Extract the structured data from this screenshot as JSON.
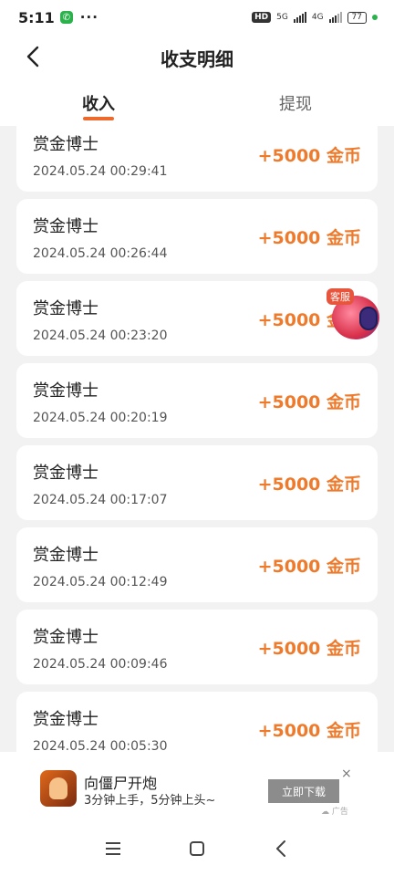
{
  "status_bar": {
    "time": "5:11",
    "more": "···",
    "hd": "HD",
    "net1": "5G",
    "net2": "4G",
    "battery": "77"
  },
  "header": {
    "title": "收支明细",
    "back_icon": "chevron-left-icon"
  },
  "tabs": [
    {
      "label": "收入",
      "active": true
    },
    {
      "label": "提现",
      "active": false
    }
  ],
  "records": [
    {
      "name": "赏金博士",
      "date": "2024.05.24 00:29:41",
      "amount": "+5000 金币"
    },
    {
      "name": "赏金博士",
      "date": "2024.05.24 00:26:44",
      "amount": "+5000 金币"
    },
    {
      "name": "赏金博士",
      "date": "2024.05.24 00:23:20",
      "amount": "+5000 金币"
    },
    {
      "name": "赏金博士",
      "date": "2024.05.24 00:20:19",
      "amount": "+5000 金币"
    },
    {
      "name": "赏金博士",
      "date": "2024.05.24 00:17:07",
      "amount": "+5000 金币"
    },
    {
      "name": "赏金博士",
      "date": "2024.05.24 00:12:49",
      "amount": "+5000 金币"
    },
    {
      "name": "赏金博士",
      "date": "2024.05.24 00:09:46",
      "amount": "+5000 金币"
    },
    {
      "name": "赏金博士",
      "date": "2024.05.24 00:05:30",
      "amount": "+5000 金币"
    }
  ],
  "customer_service": {
    "badge": "客服",
    "icon": "customer-service-icon"
  },
  "ad": {
    "title": "向僵尸开炮",
    "subtitle": "3分钟上手，5分钟上头~",
    "button": "立即下载",
    "close": "×",
    "mark": "广告"
  },
  "navbar": {
    "menu_icon": "menu-icon",
    "home_icon": "home-icon",
    "back_icon": "back-icon"
  },
  "colors": {
    "accent": "#ee6a2c",
    "amount": "#ee7a2c",
    "background": "#f2f2f2"
  }
}
